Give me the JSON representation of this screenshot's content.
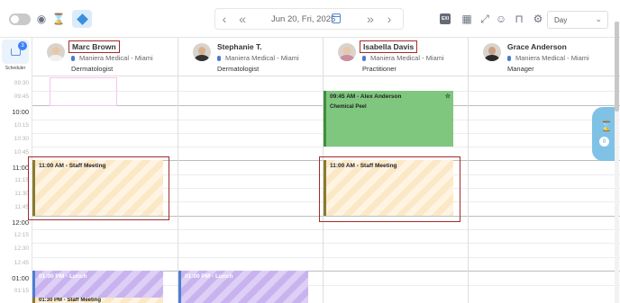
{
  "toolbar": {
    "date": "Jun 20, Fri, 2025",
    "view": "Day",
    "badge": "EXI"
  },
  "rail": {
    "badge_count": "3",
    "label": "Scheduler"
  },
  "employees": [
    {
      "name": "Marc Brown",
      "location": "Maniera Medical - Miami",
      "role": "Dermatologist"
    },
    {
      "name": "Stephanie T.",
      "location": "Maniera Medical - Miami",
      "role": "Dermatologist"
    },
    {
      "name": "Isabella Davis",
      "location": "Maniera Medical - Miami",
      "role": "Practitioner"
    },
    {
      "name": "Grace Anderson",
      "location": "Maniera Medical - Miami",
      "role": "Manager"
    }
  ],
  "times": {
    "t0930": "09:30",
    "t0945": "09:45",
    "t1000": "10:00",
    "t1015": "10:15",
    "t1030": "10:30",
    "t1045": "10:45",
    "t1100": "11:00",
    "t1115": "11:15",
    "t1130": "11:30",
    "t1145": "11:45",
    "t1200": "12:00",
    "t1215": "12:15",
    "t1230": "12:30",
    "t1245": "12:45",
    "t0100": "01:00",
    "t0115": "01:15"
  },
  "events": {
    "alex": {
      "title": "09:45 AM - Alex Anderson",
      "sub": "Chemical Peel"
    },
    "meeting1": {
      "title": "11:00 AM - Staff Meeting"
    },
    "meeting2": {
      "title": "11:00 AM - Staff Meeting"
    },
    "lunch1": {
      "title": "01:00 PM - Lunch"
    },
    "lunch2": {
      "title": "01:00 PM - Lunch"
    },
    "meeting3": {
      "title": "01:30 PM - Staff Meeting"
    }
  },
  "side_tab": {
    "count": "0"
  },
  "colors": {
    "green_event": "#7fc77f",
    "highlight": "#a52a2a",
    "accent": "#3b82f6"
  }
}
